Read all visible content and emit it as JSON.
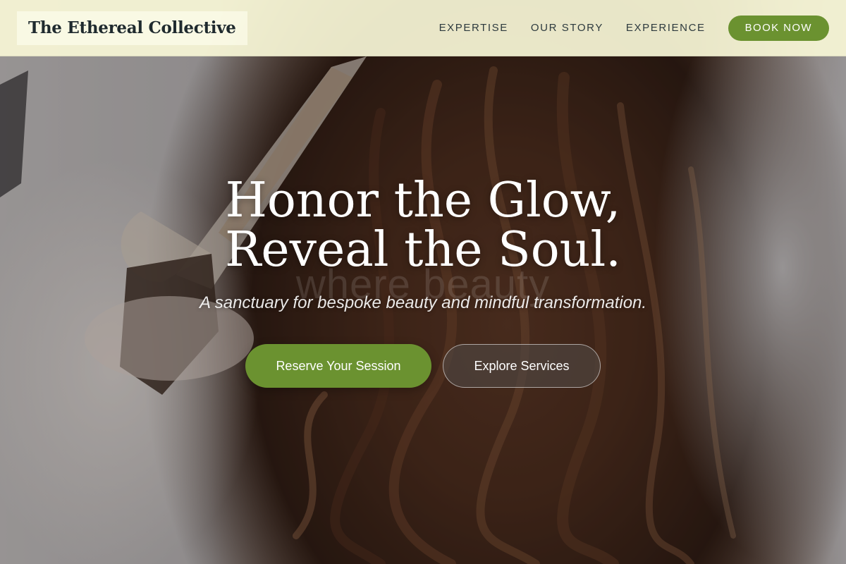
{
  "brand": {
    "name": "The Ethereal Collective"
  },
  "nav": {
    "links": [
      "EXPERTISE",
      "OUR STORY",
      "EXPERIENCE"
    ],
    "book_label": "BOOK NOW"
  },
  "hero": {
    "title_line1": "Honor the Glow,",
    "title_line2": "Reveal the Soul.",
    "ghost_text": "where beauty",
    "subtitle": "A sanctuary for bespoke beauty and mindful transformation.",
    "primary_cta": "Reserve Your Session",
    "secondary_cta": "Explore Services"
  },
  "colors": {
    "accent": "#6b9230",
    "header_bg": "#f7f6d6",
    "brand_text": "#1f2a2e"
  }
}
